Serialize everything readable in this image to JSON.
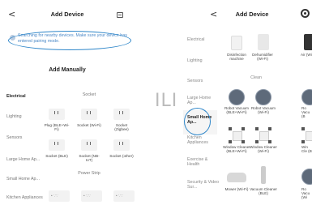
{
  "left": {
    "back_glyph": "<",
    "title": "Add Device",
    "scan_icon": "scan-icon",
    "search": {
      "text": "Searching for nearby devices. Make sure your device has entered",
      "link": "pairing mode.",
      "icon": "search-indicator-icon"
    },
    "add_manually": "Add Manually",
    "categories": [
      "Electrical",
      "Lighting",
      "Sensors",
      "Large Home Ap...",
      "Small Home Ap...",
      "Kitchen Appliances"
    ],
    "active_category": "Electrical",
    "groups": [
      "Socket",
      "Power Strip"
    ],
    "devices": [
      {
        "label": "Plug (BLE+Wi-Fi)"
      },
      {
        "label": "Socket (Wi-Fi)"
      },
      {
        "label": "Socket (Zigbee)"
      },
      {
        "label": "Socket (BLE)"
      },
      {
        "label": "Socket (NB-IoT)"
      },
      {
        "label": "Socket (other)"
      }
    ]
  },
  "divider": "ILI",
  "right": {
    "back_glyph": "<",
    "title": "Add Device",
    "settings_icon": "gear-icon",
    "categories": [
      "Electrical",
      "Lighting",
      "Sensors",
      "Large Home Ap...",
      "Small Home Ap...",
      "Kitchen Appliances",
      "Exercise & Health",
      "Security & Video Sur..."
    ],
    "active_category": "Small Home Ap...",
    "group": "Clean",
    "top_devices": [
      {
        "label": "Disinfection machine"
      },
      {
        "label": "Dehumidifier (Wi-Fi)"
      },
      {
        "label": "Air (Wi"
      }
    ],
    "devices": [
      {
        "label": "Robot Vacuum (BLE+Wi-Fi)"
      },
      {
        "label": "Robot Vacuum (Wi-Fi)"
      },
      {
        "label": "Ro Vacu (B"
      },
      {
        "label": "Window Cleaner (BLE+Wi-Fi)"
      },
      {
        "label": "Window Cleaner (Wi-Fi)"
      },
      {
        "label": "Win Cle (B"
      },
      {
        "label": "Mower (Wi-Fi)"
      },
      {
        "label": "Vacuum Cleaner (BLE)"
      },
      {
        "label": "Ro Vacu (Wi"
      }
    ]
  },
  "colors": {
    "highlight": "#2e86c9",
    "link": "#4a88c7",
    "robot": "#5e6a7a"
  }
}
